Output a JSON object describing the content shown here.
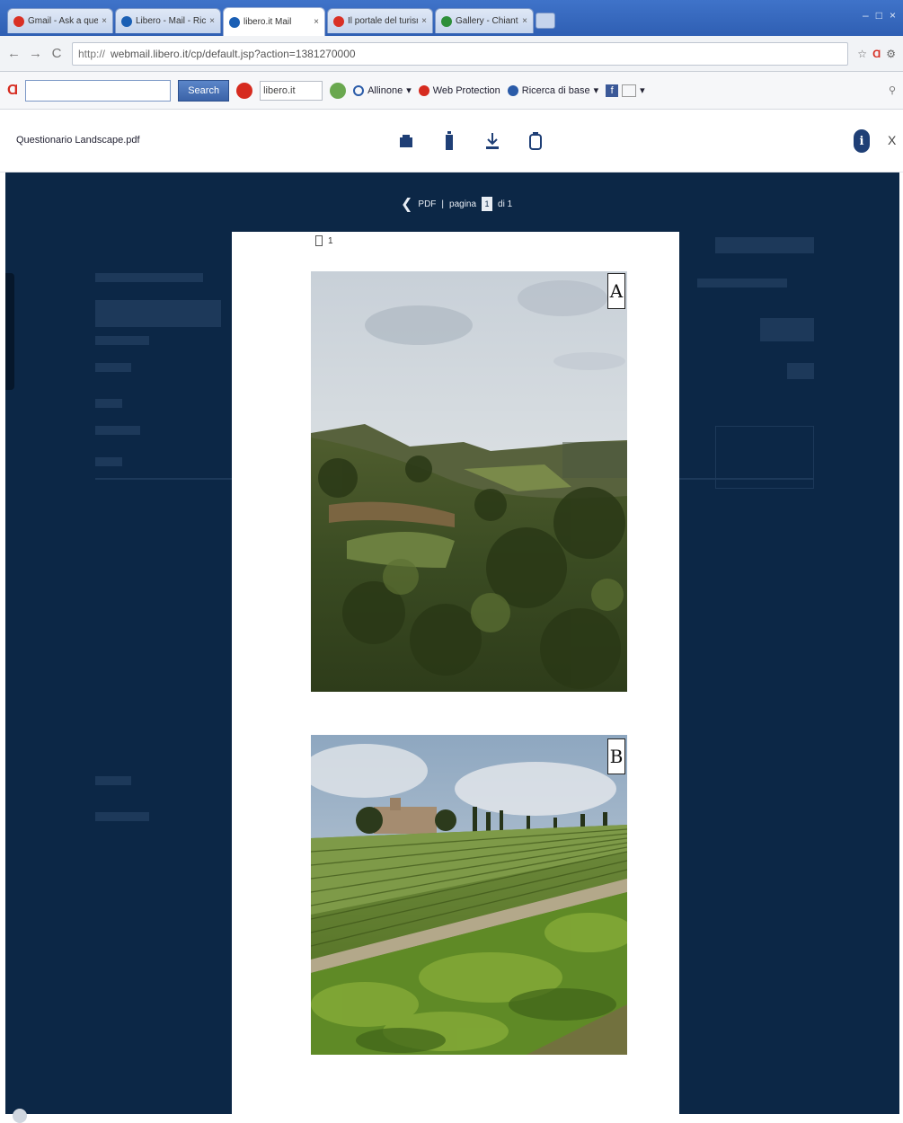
{
  "browser": {
    "tabs": [
      {
        "title": "Gmail - Ask a question",
        "favicon_color": "#d93025"
      },
      {
        "title": "Libero - Mail - Ricerca in a",
        "favicon_color": "#1a5fb4"
      },
      {
        "title": "libero.it Mail",
        "favicon_color": "#1a5fb4"
      },
      {
        "title": "Il portale del turismo",
        "favicon_color": "#d93025"
      },
      {
        "title": "Gallery - Chianti region",
        "favicon_color": "#2d8f3a"
      }
    ],
    "window_controls": {
      "minimize": "–",
      "maximize": "□",
      "close": "×"
    },
    "url_scheme": "http://",
    "url": "webmail.libero.it/cp/default.jsp?action=1381270000"
  },
  "toolbar": {
    "search_button": "Search",
    "field_value": "libero.it",
    "items": [
      "Allinone",
      "Web Protection",
      "Ricerca di base"
    ]
  },
  "viewer": {
    "document_name": "Questionario Landscape.pdf",
    "pager": {
      "prefix": "PDF",
      "separator": "|",
      "label": "pagina",
      "current": "1",
      "suffix": "di 1"
    },
    "info_label": "i",
    "close_label": "X"
  },
  "page": {
    "page_mark": "1",
    "photos": [
      {
        "label": "A",
        "subject": "Tuscan hillside with olive groves and woodland"
      },
      {
        "label": "B",
        "subject": "Vineyard rows below a hilltop villa with cypress trees"
      }
    ]
  },
  "icons": {
    "back": "back-arrow-icon",
    "forward": "forward-arrow-icon",
    "reload": "reload-icon",
    "star": "star-icon",
    "wrench": "wrench-icon",
    "print": "print-icon",
    "save": "save-icon",
    "download": "download-icon",
    "attach": "attach-icon"
  },
  "colors": {
    "tabbar": "#2f5fb3",
    "viewer_background": "#0c2746",
    "viewer_icons": "#1f3f76"
  }
}
